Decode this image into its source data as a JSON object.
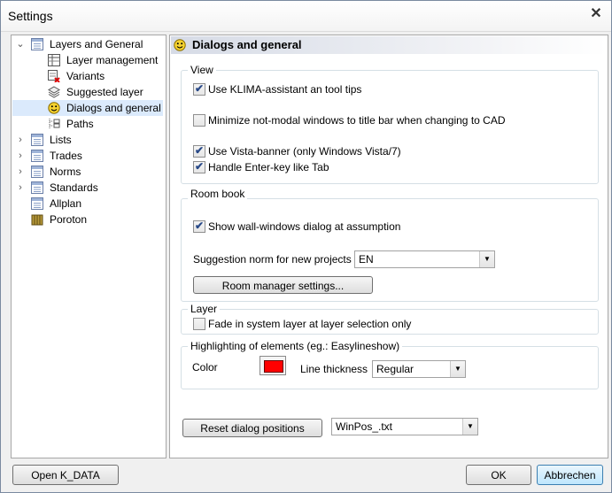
{
  "window": {
    "title": "Settings",
    "close_glyph": "✕"
  },
  "tree": {
    "items": [
      {
        "label": "Layers and General",
        "icon": "list-sheet-icon",
        "expander": "⌄"
      },
      {
        "label": "Layer management",
        "icon": "layer-table-icon"
      },
      {
        "label": "Variants",
        "icon": "variants-icon"
      },
      {
        "label": "Suggested layer",
        "icon": "layer-stack-icon"
      },
      {
        "label": "Dialogs and general",
        "icon": "smiley-icon"
      },
      {
        "label": "Paths",
        "icon": "paths-icon"
      },
      {
        "label": "Lists",
        "icon": "list-sheet-icon",
        "expander": "›"
      },
      {
        "label": "Trades",
        "icon": "list-sheet-icon",
        "expander": "›"
      },
      {
        "label": "Norms",
        "icon": "list-sheet-icon",
        "expander": "›"
      },
      {
        "label": "Standards",
        "icon": "list-sheet-icon",
        "expander": "›"
      },
      {
        "label": "Allplan",
        "icon": "list-sheet-icon"
      },
      {
        "label": "Poroton",
        "icon": "brick-icon"
      }
    ],
    "selected_index": 4
  },
  "panel": {
    "header": "Dialogs and general",
    "view": {
      "title": "View",
      "klima": {
        "label": "Use KLIMA-assistant an tool tips",
        "checked": true
      },
      "minimize": {
        "label": "Minimize not-modal windows to title bar when changing to CAD",
        "checked": false
      },
      "vista": {
        "label": "Use Vista-banner (only Windows Vista/7)",
        "checked": true
      },
      "enter": {
        "label": "Handle Enter-key like Tab",
        "checked": true
      }
    },
    "roombook": {
      "title": "Room book",
      "wall": {
        "label": "Show wall-windows dialog at assumption",
        "checked": true
      },
      "norm_label": "Suggestion norm for new projects",
      "norm_value": "EN",
      "manager_button": "Room manager settings..."
    },
    "layer": {
      "title": "Layer",
      "fade": {
        "label": "Fade in system layer at layer selection only",
        "checked": false
      }
    },
    "highlight": {
      "title": "Highlighting of elements (eg.: Easylineshow)",
      "color_label": "Color",
      "color_value": "#ff0000",
      "thickness_label": "Line thickness",
      "thickness_value": "Regular"
    },
    "reset_button": "Reset dialog positions",
    "winpos_value": "WinPos_.txt"
  },
  "footer": {
    "open_button": "Open K_DATA",
    "ok_button": "OK",
    "cancel_button": "Abbrechen"
  }
}
